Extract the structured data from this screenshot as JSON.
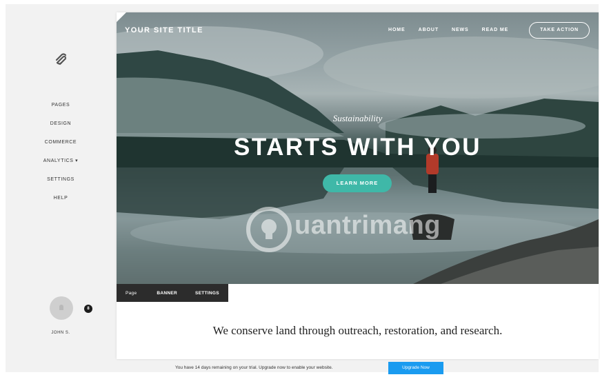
{
  "sidebar": {
    "logo_icon": "squarespace-logo-icon",
    "items": [
      {
        "label": "PAGES"
      },
      {
        "label": "DESIGN"
      },
      {
        "label": "COMMERCE"
      },
      {
        "label": "ANALYTICS ▾"
      },
      {
        "label": "SETTINGS"
      },
      {
        "label": "HELP"
      }
    ],
    "notification_count": "8",
    "user_name": "JOHN S."
  },
  "site": {
    "title": "YOUR SITE TITLE",
    "nav": [
      "HOME",
      "ABOUT",
      "NEWS",
      "READ ME"
    ],
    "cta_label": "TAKE ACTION",
    "tagline": "Sustainability",
    "headline": "STARTS WITH YOU",
    "learn_more_label": "LEARN MORE",
    "mission": "We conserve land through outreach, restoration, and research."
  },
  "block_toolbar": {
    "items": [
      "Page",
      "BANNER",
      "SETTINGS"
    ]
  },
  "watermark": {
    "text": "uantrimang"
  },
  "trial": {
    "message": "You have 14 days remaining on your trial. Upgrade now to enable your website.",
    "button_label": "Upgrade Now"
  },
  "colors": {
    "accent_teal": "#3fb8a8",
    "upgrade_blue": "#1a9bf0",
    "toolbar_dark": "#2c2c2c"
  }
}
